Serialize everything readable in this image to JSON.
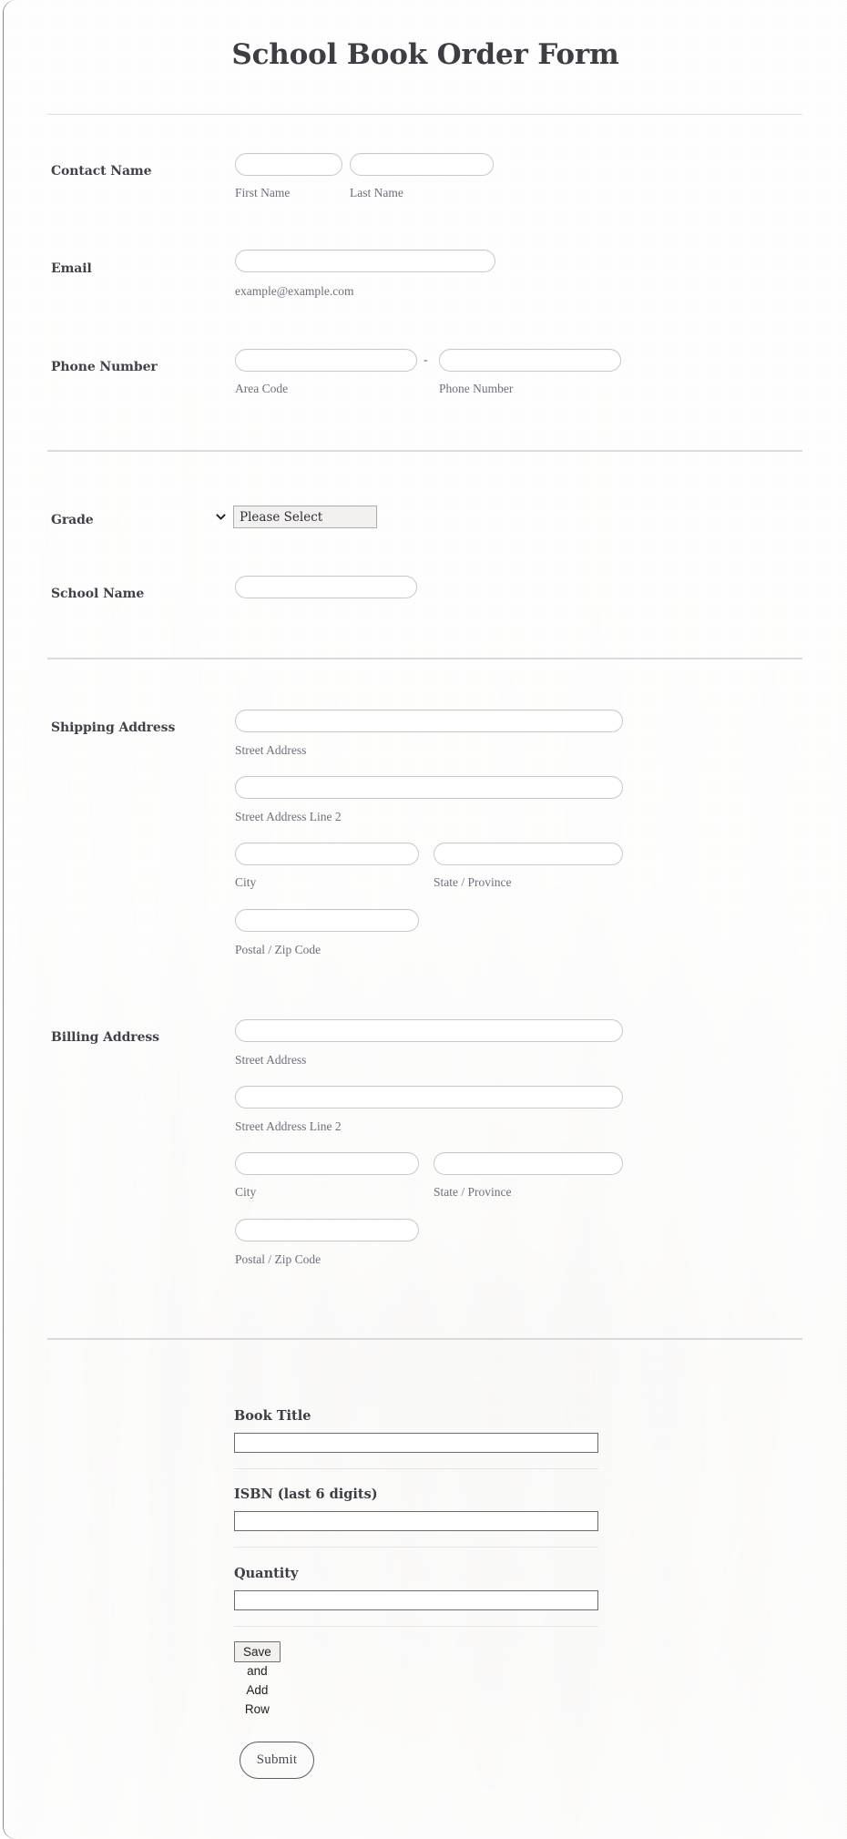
{
  "form": {
    "title": "School Book Order Form",
    "submit_label": "Submit"
  },
  "contact_name": {
    "label": "Contact Name",
    "first": {
      "sub_label": "First Name",
      "value": "",
      "placeholder": ""
    },
    "last": {
      "sub_label": "Last Name",
      "value": "",
      "placeholder": ""
    }
  },
  "email": {
    "label": "Email",
    "sub_label": "example@example.com",
    "value": "",
    "placeholder": ""
  },
  "phone": {
    "label": "Phone Number",
    "separator": "-",
    "area_code": {
      "sub_label": "Area Code",
      "value": "",
      "placeholder": ""
    },
    "number": {
      "sub_label": "Phone Number",
      "value": "",
      "placeholder": ""
    }
  },
  "grade": {
    "label": "Grade",
    "selected": "Please Select",
    "options": [
      "Please Select"
    ]
  },
  "school_name": {
    "label": "School Name",
    "value": "",
    "placeholder": ""
  },
  "shipping_address": {
    "label": "Shipping Address",
    "street": {
      "sub_label": "Street Address",
      "value": ""
    },
    "street2": {
      "sub_label": "Street Address Line 2",
      "value": ""
    },
    "city": {
      "sub_label": "City",
      "value": ""
    },
    "state": {
      "sub_label": "State / Province",
      "value": ""
    },
    "postal": {
      "sub_label": "Postal / Zip Code",
      "value": ""
    }
  },
  "billing_address": {
    "label": "Billing Address",
    "street": {
      "sub_label": "Street Address",
      "value": ""
    },
    "street2": {
      "sub_label": "Street Address Line 2",
      "value": ""
    },
    "city": {
      "sub_label": "City",
      "value": ""
    },
    "state": {
      "sub_label": "State / Province",
      "value": ""
    },
    "postal": {
      "sub_label": "Postal / Zip Code",
      "value": ""
    }
  },
  "book_details": {
    "book_title": {
      "label": "Book Title",
      "value": ""
    },
    "isbn": {
      "label": "ISBN (last 6 digits)",
      "value": ""
    },
    "quantity": {
      "label": "Quantity",
      "value": ""
    },
    "save_add_row_label": "Save and Add Row"
  }
}
